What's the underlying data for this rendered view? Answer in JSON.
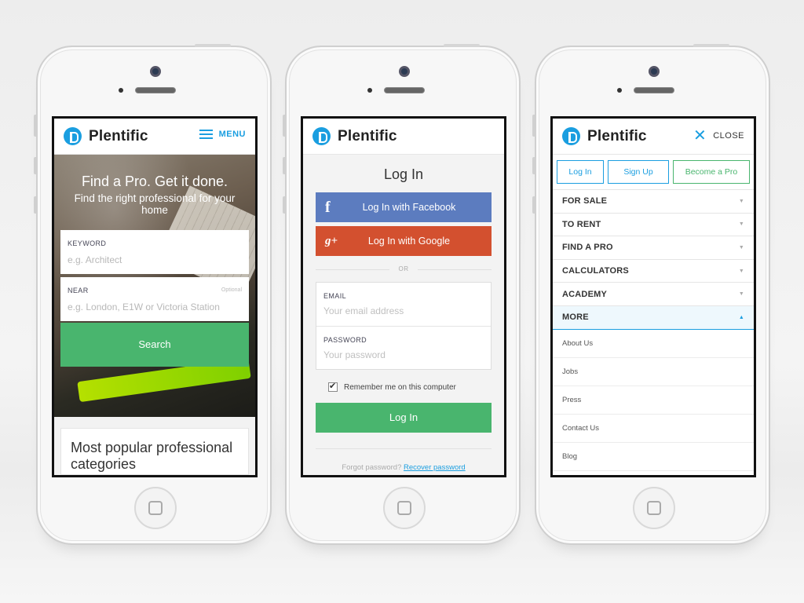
{
  "brand": {
    "name": "Plentific",
    "accent": "#1a9ee0",
    "success": "#49b56e",
    "facebook": "#5c7cbf",
    "google": "#d3502f"
  },
  "home_screen": {
    "menu_label": "MENU",
    "hero_title": "Find a Pro. Get it done.",
    "hero_subtitle": "Find the right professional for your home",
    "keyword": {
      "label": "KEYWORD",
      "placeholder": "e.g. Architect"
    },
    "near": {
      "label": "NEAR",
      "optional": "Optional",
      "placeholder": "e.g. London, E1W or Victoria Station"
    },
    "search_label": "Search",
    "popular_title": "Most popular professional categories"
  },
  "login_screen": {
    "title": "Log In",
    "facebook_label": "Log In with Facebook",
    "facebook_icon": "f",
    "google_label": "Log In with Google",
    "google_icon": "g+",
    "or_label": "OR",
    "email": {
      "label": "EMAIL",
      "placeholder": "Your email address"
    },
    "password": {
      "label": "PASSWORD",
      "placeholder": "Your password"
    },
    "remember_label": "Remember me on this computer",
    "remember_checked": true,
    "login_label": "Log In",
    "forgot_label": "Forgot password?",
    "recover_label": "Recover password"
  },
  "menu_screen": {
    "close_label": "CLOSE",
    "login_label": "Log In",
    "signup_label": "Sign Up",
    "become_pro_label": "Become a Pro",
    "nav_items": [
      {
        "label": "FOR SALE",
        "open": false
      },
      {
        "label": "TO RENT",
        "open": false
      },
      {
        "label": "FIND A PRO",
        "open": false
      },
      {
        "label": "CALCULATORS",
        "open": false
      },
      {
        "label": "ACADEMY",
        "open": false
      },
      {
        "label": "MORE",
        "open": true
      }
    ],
    "sub_items": [
      "About Us",
      "Jobs",
      "Press",
      "Contact Us",
      "Blog"
    ]
  }
}
